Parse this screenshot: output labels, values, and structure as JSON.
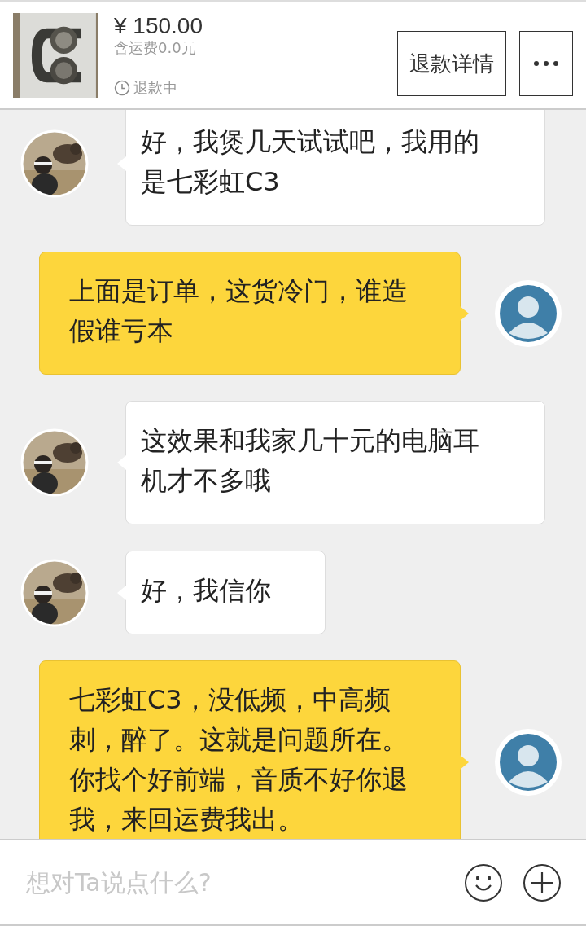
{
  "product": {
    "price": "¥ 150.00",
    "shipping": "含运费0.0元",
    "status": "退款中"
  },
  "buttons": [
    {
      "kind": "text",
      "label": "退款详情"
    },
    {
      "kind": "more"
    }
  ],
  "messages": [
    {
      "kind": "received",
      "text": "好，我煲几天试试吧，我用的是七彩虹C3"
    },
    {
      "kind": "sent",
      "text": "上面是订单，这货冷门，谁造假谁亏本"
    },
    {
      "kind": "received",
      "text": "这效果和我家几十元的电脑耳机才不多哦"
    },
    {
      "kind": "received",
      "text": "好，我信你"
    },
    {
      "kind": "sent",
      "text": "七彩虹C3，没低频，中高频刺，醉了。这就是问题所在。你找个好前端，音质不好你退我，来回运费我出。"
    }
  ],
  "input": {
    "placeholder": "想对Ta说点什么?"
  }
}
